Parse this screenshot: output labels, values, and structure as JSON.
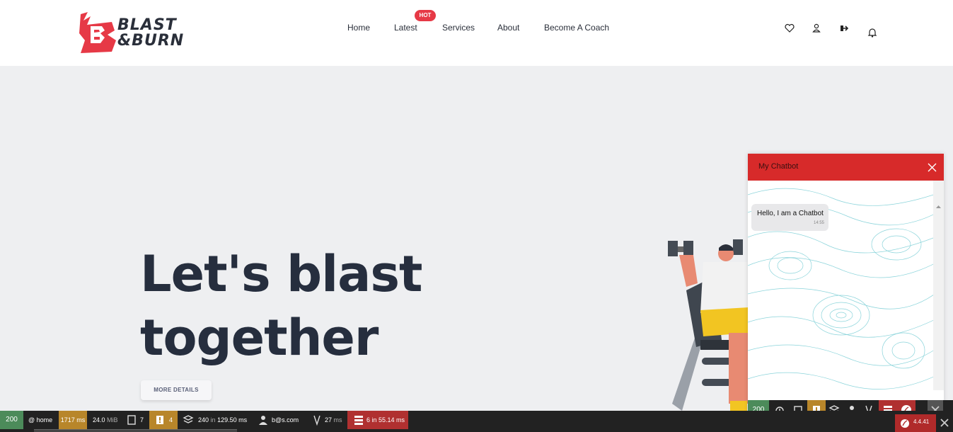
{
  "brand": {
    "line1": "BLAST",
    "line2": "&BURN",
    "colors": {
      "red": "#e63946",
      "dark": "#2a2f3a"
    }
  },
  "nav": {
    "items": [
      {
        "label": "Home"
      },
      {
        "label": "Latest",
        "badge": "HOT"
      },
      {
        "label": "Services"
      },
      {
        "label": "About"
      },
      {
        "label": "Become A Coach"
      }
    ],
    "icons": [
      "heart-icon",
      "user-icon",
      "logout-icon",
      "bell-icon"
    ]
  },
  "hero": {
    "title_line1": "Let's blast",
    "title_line2": "together",
    "button": "MORE DETAILS"
  },
  "chat": {
    "title": "My Chatbot",
    "messages": [
      {
        "text": "Hello, I am a Chatbot",
        "time": "14:55"
      }
    ]
  },
  "debugbar": {
    "status": "200",
    "route": "@ home",
    "time": "1717 ms",
    "memory": "24.0",
    "memory_unit": "MiB",
    "forms": "7",
    "logs": "4",
    "queries": "240",
    "queries_in": "in",
    "queries_time": "129.50 ms",
    "user": "b@s.com",
    "events": "27",
    "events_unit": "ms",
    "db2": "6 in 55.14 ms",
    "status2": "200",
    "version": "4.4.41"
  }
}
